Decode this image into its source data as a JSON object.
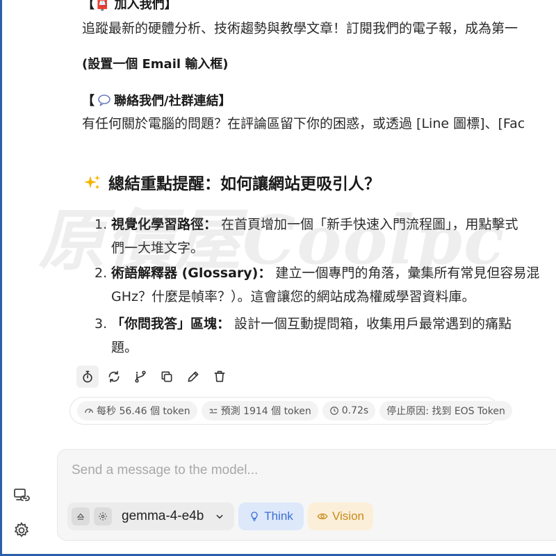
{
  "message": {
    "join_head": "【📮 加入我們】",
    "join_text": "追蹤最新的硬體分析、技術趨勢與教學文章！訂閱我們的電子報，成為第一",
    "email_note": "(設置一個 Email 輸入框)",
    "contact_head_pre": "【",
    "contact_head_post": "聯絡我們/社群連結】",
    "contact_text": "有任何關於電腦的問題？在評論區留下你的困惑，或透過 [Line 圖標]、[Fac",
    "summary_title": "總結重點提醒：如何讓網站更吸引人？",
    "list": [
      {
        "num": "1.",
        "title": "視覺化學習路徑：",
        "text": " 在首頁增加一個「新手快速入門流程圖」，用點擊式",
        "cont": "們一大堆文字。"
      },
      {
        "num": "2.",
        "title": "術語解釋器 (Glossary)：",
        "text": " 建立一個專門的角落，彙集所有常見但容易混",
        "cont": "GHz？什麼是幀率？）。這會讓您的網站成為權威學習資料庫。"
      },
      {
        "num": "3.",
        "title": "「你問我答」區塊：",
        "text": " 設計一個互動提問箱，收集用戶最常遇到的痛點",
        "cont": "題。"
      }
    ]
  },
  "watermark": "原價屋Coolpc",
  "actions": [
    "timer-icon",
    "regenerate-icon",
    "branch-icon",
    "copy-icon",
    "edit-icon",
    "delete-icon"
  ],
  "stats": {
    "speed": "每秒 56.46 個 token",
    "predicted": "預測 1914 個 token",
    "time": "0.72s",
    "stop_reason": "停止原因: 找到 EOS Token"
  },
  "composer": {
    "placeholder": "Send a message to the model...",
    "model": "gemma-4-e4b",
    "think_label": "Think",
    "vision_label": "Vision"
  },
  "colors": {
    "think": "#3b6fd4",
    "vision": "#c98a1a",
    "frame": "#2b5fab"
  }
}
